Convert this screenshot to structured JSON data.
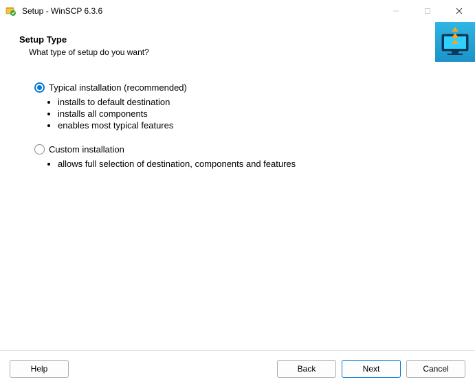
{
  "window": {
    "title": "Setup - WinSCP 6.3.6"
  },
  "header": {
    "title": "Setup Type",
    "subtitle": "What type of setup do you want?"
  },
  "options": {
    "typical": {
      "label": "Typical installation (recommended)",
      "selected": true,
      "bullets": [
        "installs to default destination",
        "installs all components",
        "enables most typical features"
      ]
    },
    "custom": {
      "label": "Custom installation",
      "selected": false,
      "bullets": [
        "allows full selection of destination, components and features"
      ]
    }
  },
  "footer": {
    "help": "Help",
    "back": "Back",
    "next": "Next",
    "cancel": "Cancel"
  }
}
